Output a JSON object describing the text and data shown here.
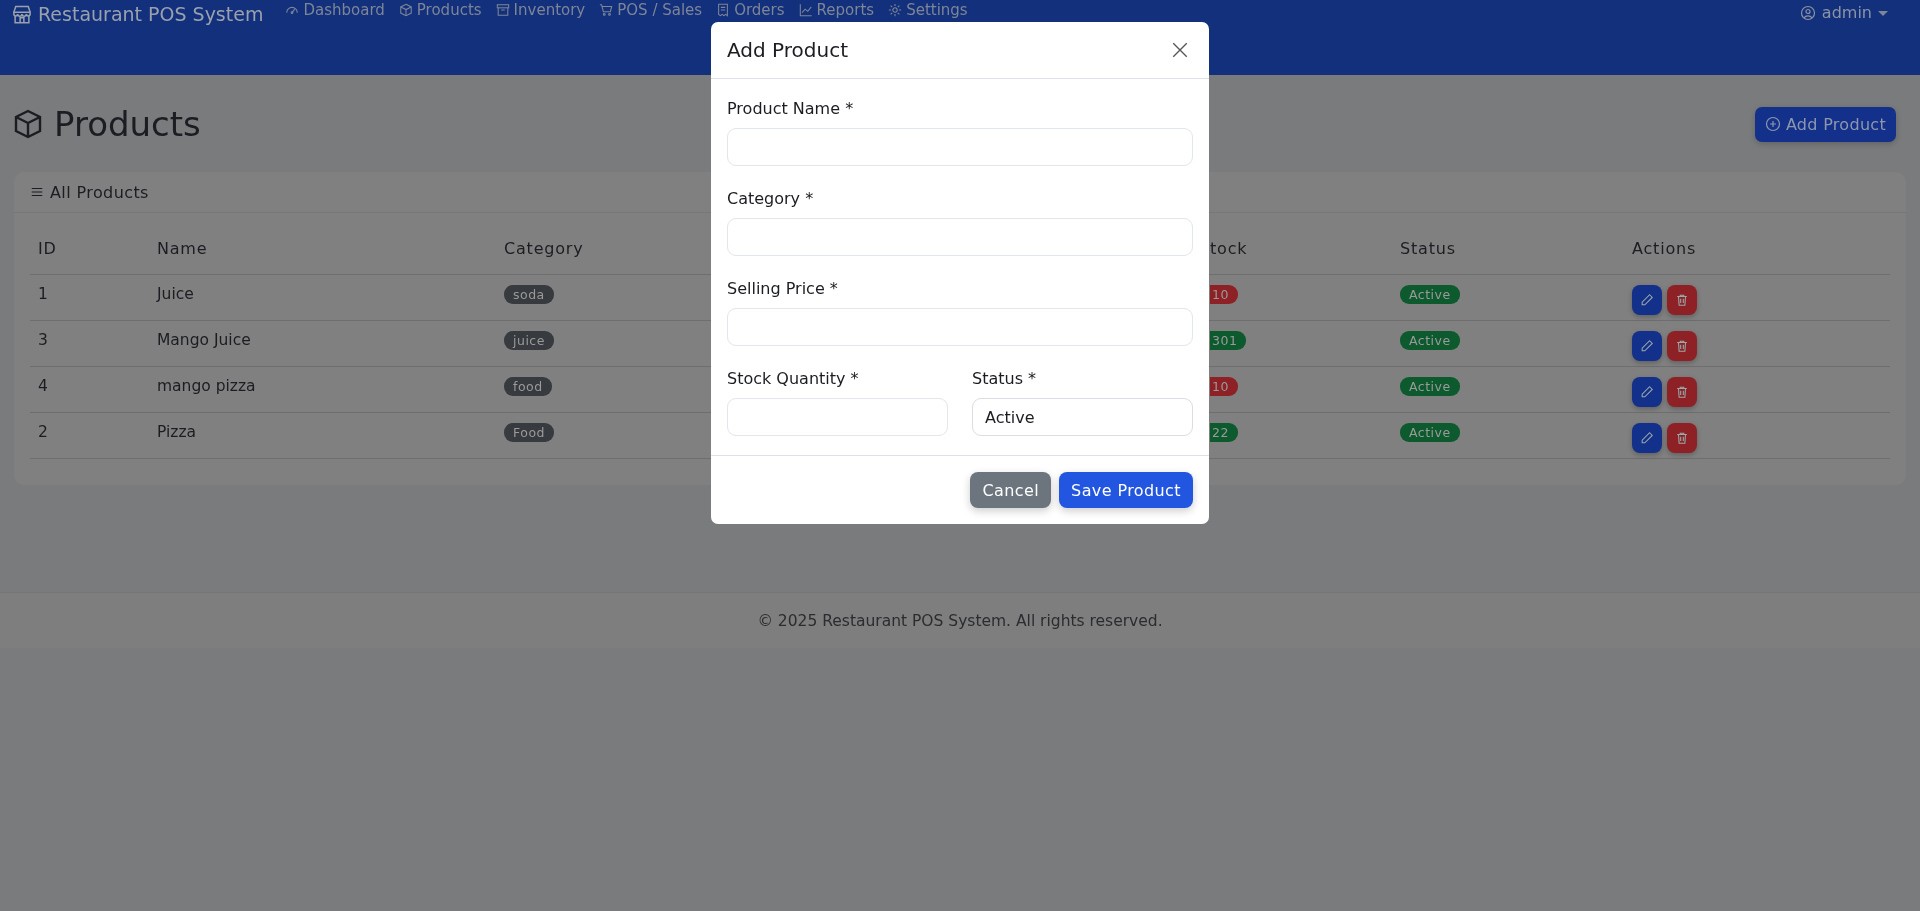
{
  "navbar": {
    "brand": "Restaurant POS System",
    "items": [
      {
        "label": "Dashboard"
      },
      {
        "label": "Products"
      },
      {
        "label": "Inventory"
      },
      {
        "label": "POS / Sales"
      },
      {
        "label": "Orders"
      },
      {
        "label": "Reports"
      },
      {
        "label": "Settings"
      }
    ],
    "user": "admin"
  },
  "page": {
    "title": "Products",
    "add_button": "Add Product"
  },
  "card": {
    "title": "All Products",
    "columns": [
      "ID",
      "Name",
      "Category",
      "tock",
      "Status",
      "Actions"
    ],
    "rows": [
      {
        "id": "1",
        "name": "Juice",
        "category": "soda",
        "stock": {
          "label": "10",
          "color": "#8e2125"
        },
        "status": "Active"
      },
      {
        "id": "3",
        "name": "Mango Juice",
        "category": "juice",
        "stock": {
          "label": "301",
          "color": "#0c5a2e"
        },
        "status": "Active"
      },
      {
        "id": "4",
        "name": "mango pizza",
        "category": "food",
        "stock": {
          "label": "10",
          "color": "#8e2125"
        },
        "status": "Active"
      },
      {
        "id": "2",
        "name": "Pizza",
        "category": "Food",
        "stock": {
          "label": "22",
          "color": "#0c5a2e"
        },
        "status": "Active"
      }
    ]
  },
  "footer": "© 2025 Restaurant POS System. All rights reserved.",
  "modal": {
    "title": "Add Product",
    "fields": [
      {
        "label": "Product Name *",
        "kind": "input"
      },
      {
        "label": "Category *",
        "kind": "input"
      },
      {
        "label": "Selling Price *",
        "kind": "input"
      },
      {
        "label": "Stock Quantity *",
        "kind": "input"
      },
      {
        "label": "Status *",
        "kind": "select",
        "value": "Active"
      }
    ],
    "buttons": [
      {
        "label": "Cancel",
        "kind": "secondary"
      },
      {
        "label": "Save Product",
        "kind": "primary"
      }
    ]
  }
}
